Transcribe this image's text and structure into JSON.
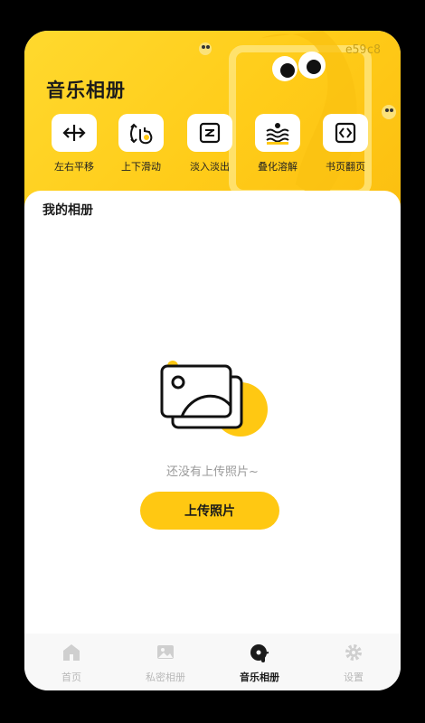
{
  "page": {
    "title": "音乐相册",
    "corner_tag": "e59c8"
  },
  "effects": [
    {
      "label": "左右平移",
      "icon": "horizontal-arrows-icon"
    },
    {
      "label": "上下滑动",
      "icon": "swipe-hand-icon"
    },
    {
      "label": "淡入淡出",
      "icon": "fade-icon"
    },
    {
      "label": "叠化溶解",
      "icon": "dissolve-waves-icon"
    },
    {
      "label": "书页翻页",
      "icon": "page-flip-icon"
    }
  ],
  "album": {
    "section_title": "我的相册",
    "empty_text": "还没有上传照片~",
    "upload_button": "上传照片"
  },
  "tabbar": [
    {
      "label": "首页",
      "icon": "home-icon",
      "active": false
    },
    {
      "label": "私密相册",
      "icon": "private-album-icon",
      "active": false
    },
    {
      "label": "音乐相册",
      "icon": "music-disc-icon",
      "active": true
    },
    {
      "label": "设置",
      "icon": "gear-icon",
      "active": false
    }
  ],
  "colors": {
    "accent": "#ffc812",
    "hero": "#ffd92e",
    "background": "#000000"
  }
}
